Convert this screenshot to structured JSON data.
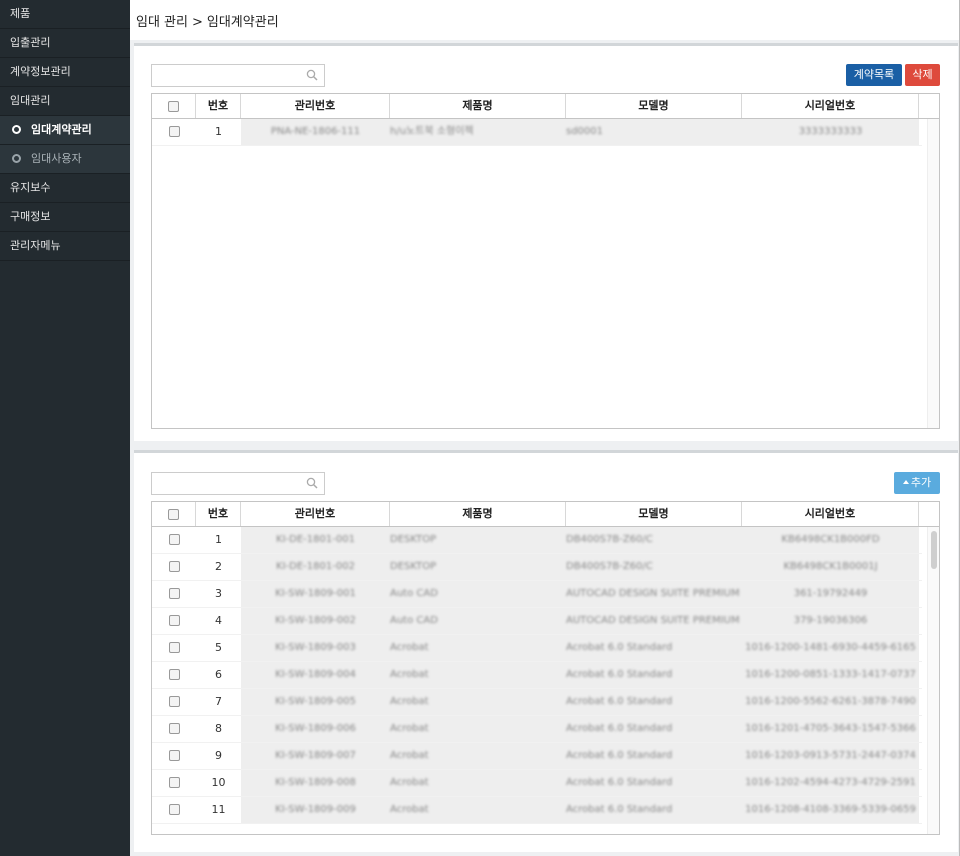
{
  "sidebar": {
    "items": [
      {
        "label": "제품"
      },
      {
        "label": "입출관리"
      },
      {
        "label": "계약정보관리"
      },
      {
        "label": "임대관리"
      },
      {
        "label": "임대계약관리"
      },
      {
        "label": "임대사용자"
      },
      {
        "label": "유지보수"
      },
      {
        "label": "구매정보"
      },
      {
        "label": "관리자메뉴"
      }
    ]
  },
  "breadcrumb": {
    "parent": "임대 관리",
    "separator": ">",
    "current": "임대계약관리"
  },
  "top_panel": {
    "search_placeholder": "",
    "buttons": {
      "contract_list": "계약목록",
      "delete": "삭제"
    },
    "columns": [
      "번호",
      "관리번호",
      "제품명",
      "모델명",
      "시리얼번호"
    ],
    "rows": [
      {
        "no": "1",
        "mgmt": "PNA-NE-1806-111",
        "product": "h/u노트북 소형이젝",
        "model": "sd0001",
        "serial": "3333333333"
      }
    ]
  },
  "bottom_panel": {
    "search_placeholder": "",
    "buttons": {
      "add": "추가"
    },
    "columns": [
      "번호",
      "관리번호",
      "제품명",
      "모델명",
      "시리얼번호"
    ],
    "rows": [
      {
        "no": "1",
        "mgmt": "KI-DE-1801-001",
        "product": "DESKTOP",
        "model": "DB400S7B-Z60/C",
        "serial": "KB6498CK1B000FD"
      },
      {
        "no": "2",
        "mgmt": "KI-DE-1801-002",
        "product": "DESKTOP",
        "model": "DB400S7B-Z60/C",
        "serial": "KB6498CK1B0001J"
      },
      {
        "no": "3",
        "mgmt": "KI-SW-1809-001",
        "product": "Auto CAD",
        "model": "AUTOCAD DESIGN SUITE PREMIUM",
        "serial": "361-19792449"
      },
      {
        "no": "4",
        "mgmt": "KI-SW-1809-002",
        "product": "Auto CAD",
        "model": "AUTOCAD DESIGN SUITE PREMIUM",
        "serial": "379-19036306"
      },
      {
        "no": "5",
        "mgmt": "KI-SW-1809-003",
        "product": "Acrobat",
        "model": "Acrobat 6.0 Standard",
        "serial": "1016-1200-1481-6930-4459-6165"
      },
      {
        "no": "6",
        "mgmt": "KI-SW-1809-004",
        "product": "Acrobat",
        "model": "Acrobat 6.0 Standard",
        "serial": "1016-1200-0851-1333-1417-0737"
      },
      {
        "no": "7",
        "mgmt": "KI-SW-1809-005",
        "product": "Acrobat",
        "model": "Acrobat 6.0 Standard",
        "serial": "1016-1200-5562-6261-3878-7490"
      },
      {
        "no": "8",
        "mgmt": "KI-SW-1809-006",
        "product": "Acrobat",
        "model": "Acrobat 6.0 Standard",
        "serial": "1016-1201-4705-3643-1547-5366"
      },
      {
        "no": "9",
        "mgmt": "KI-SW-1809-007",
        "product": "Acrobat",
        "model": "Acrobat 6.0 Standard",
        "serial": "1016-1203-0913-5731-2447-0374"
      },
      {
        "no": "10",
        "mgmt": "KI-SW-1809-008",
        "product": "Acrobat",
        "model": "Acrobat 6.0 Standard",
        "serial": "1016-1202-4594-4273-4729-2591"
      },
      {
        "no": "11",
        "mgmt": "KI-SW-1809-009",
        "product": "Acrobat",
        "model": "Acrobat 6.0 Standard",
        "serial": "1016-1208-4108-3369-5339-0659"
      }
    ]
  }
}
